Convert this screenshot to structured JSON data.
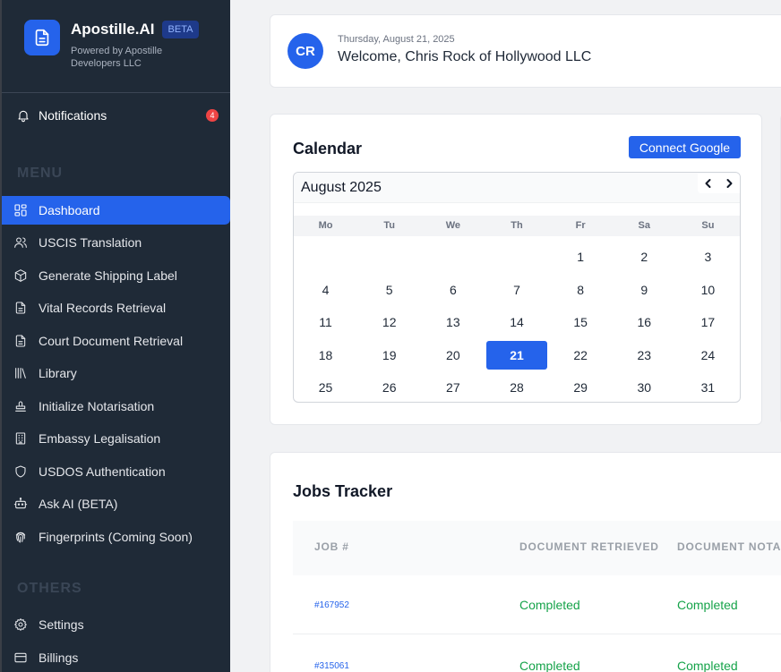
{
  "brand": {
    "name": "Apostille.AI",
    "badge": "BETA",
    "subtitle": "Powered by Apostille Developers LLC"
  },
  "notifications": {
    "label": "Notifications",
    "count": "4"
  },
  "menu": {
    "title": "MENU",
    "items": [
      {
        "label": "Dashboard",
        "icon": "dashboard-icon",
        "active": true
      },
      {
        "label": "USCIS Translation",
        "icon": "users-icon"
      },
      {
        "label": "Generate Shipping Label",
        "icon": "box-icon"
      },
      {
        "label": "Vital Records Retrieval",
        "icon": "document-icon"
      },
      {
        "label": "Court Document Retrieval",
        "icon": "document-icon"
      },
      {
        "label": "Library",
        "icon": "library-icon"
      },
      {
        "label": "Initialize Notarisation",
        "icon": "stamp-icon"
      },
      {
        "label": "Embassy Legalisation",
        "icon": "building-icon"
      },
      {
        "label": "USDOS Authentication",
        "icon": "shield-icon"
      },
      {
        "label": "Ask AI (BETA)",
        "icon": "robot-icon"
      },
      {
        "label": "Fingerprints (Coming Soon)",
        "icon": "fingerprint-icon"
      }
    ]
  },
  "others": {
    "title": "OTHERS",
    "items": [
      {
        "label": "Settings",
        "icon": "gear-icon"
      },
      {
        "label": "Billings",
        "icon": "credit-card-icon"
      }
    ]
  },
  "welcome": {
    "initials": "CR",
    "date": "Thursday, August 21, 2025",
    "title": "Welcome, Chris Rock of Hollywood LLC"
  },
  "calendar": {
    "title": "Calendar",
    "connect_label": "Connect Google",
    "month": "August 2025",
    "weekdays": [
      "Mo",
      "Tu",
      "We",
      "Th",
      "Fr",
      "Sa",
      "Su"
    ],
    "weeks": [
      [
        "",
        "",
        "",
        "",
        "1",
        "2",
        "3"
      ],
      [
        "4",
        "5",
        "6",
        "7",
        "8",
        "9",
        "10"
      ],
      [
        "11",
        "12",
        "13",
        "14",
        "15",
        "16",
        "17"
      ],
      [
        "18",
        "19",
        "20",
        "21",
        "22",
        "23",
        "24"
      ],
      [
        "25",
        "26",
        "27",
        "28",
        "29",
        "30",
        "31"
      ]
    ],
    "selected": "21"
  },
  "jobs": {
    "title": "Jobs Tracker",
    "columns": [
      "JOB #",
      "DOCUMENT RETRIEVED",
      "DOCUMENT NOTAR"
    ],
    "rows": [
      {
        "id": "#167952",
        "retrieved": "Completed",
        "notarized": "Completed"
      },
      {
        "id": "#315061",
        "retrieved": "Completed",
        "notarized": "Completed"
      }
    ]
  },
  "colors": {
    "accent": "#2563eb",
    "sidebar": "#1f2a37",
    "success": "#16a34a",
    "badge": "#ef4444"
  }
}
